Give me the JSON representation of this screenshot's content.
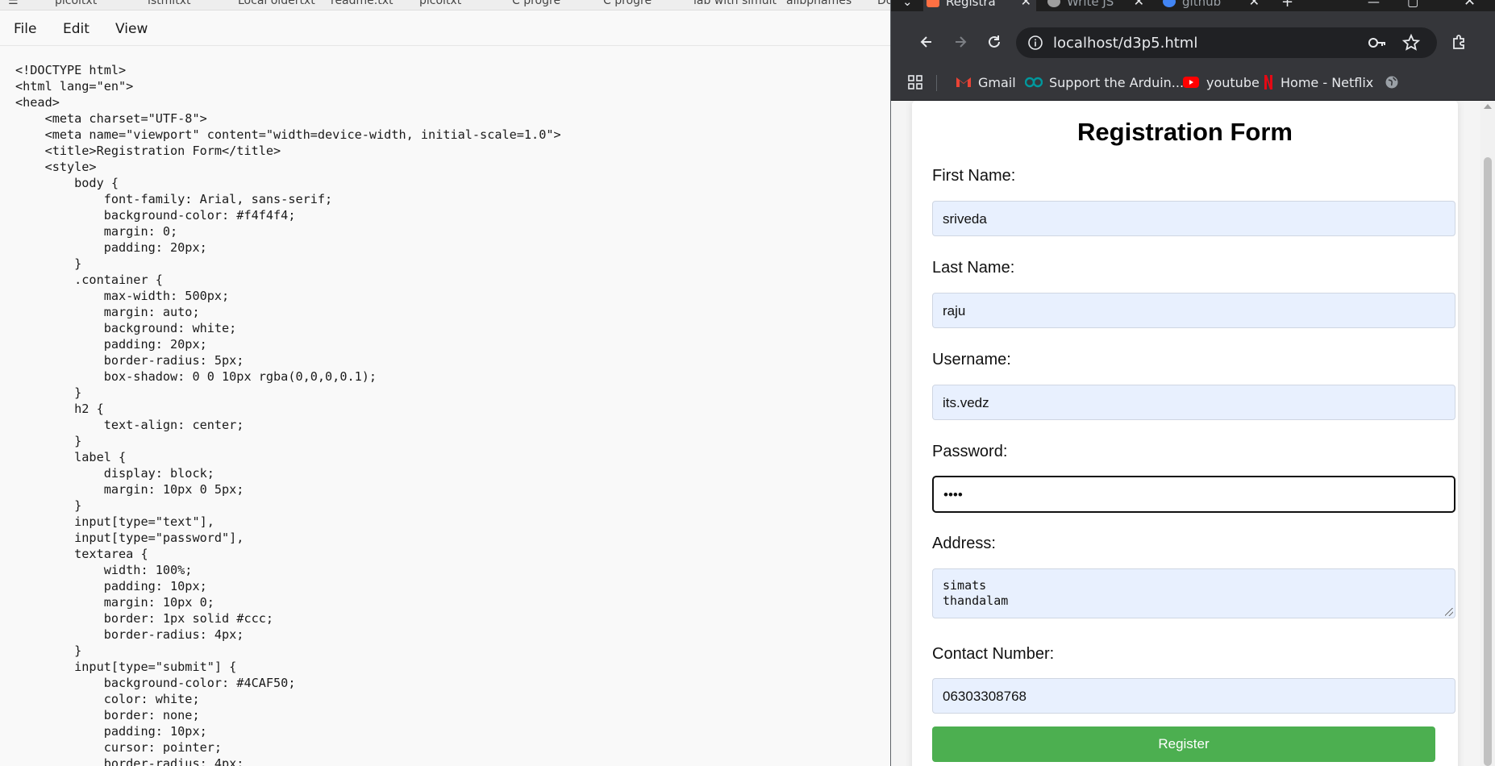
{
  "notepad": {
    "tabs": [
      "picoltxt",
      "istmltxt",
      "Local oldertxt",
      "readme.txt",
      "picoltxt",
      "C progre",
      "C progre",
      "lab with simult",
      "allbpnames",
      "Do"
    ],
    "menu": [
      "File",
      "Edit",
      "View"
    ],
    "code_lines": [
      "<!DOCTYPE html>",
      "<html lang=\"en\">",
      "<head>",
      "    <meta charset=\"UTF-8\">",
      "    <meta name=\"viewport\" content=\"width=device-width, initial-scale=1.0\">",
      "    <title>Registration Form</title>",
      "    <style>",
      "        body {",
      "            font-family: Arial, sans-serif;",
      "            background-color: #f4f4f4;",
      "            margin: 0;",
      "            padding: 20px;",
      "        }",
      "        .container {",
      "            max-width: 500px;",
      "            margin: auto;",
      "            background: white;",
      "            padding: 20px;",
      "            border-radius: 5px;",
      "            box-shadow: 0 0 10px rgba(0,0,0,0.1);",
      "        }",
      "        h2 {",
      "            text-align: center;",
      "        }",
      "        label {",
      "            display: block;",
      "            margin: 10px 0 5px;",
      "        }",
      "        input[type=\"text\"],",
      "        input[type=\"password\"],",
      "        textarea {",
      "            width: 100%;",
      "            padding: 10px;",
      "            margin: 10px 0;",
      "            border: 1px solid #ccc;",
      "            border-radius: 4px;",
      "        }",
      "        input[type=\"submit\"] {",
      "            background-color: #4CAF50;",
      "            color: white;",
      "            border: none;",
      "            padding: 10px;",
      "            cursor: pointer;",
      "            border-radius: 4px;"
    ]
  },
  "browser": {
    "tabs": [
      {
        "title": "Registra",
        "active": true,
        "icon_color": "#ff7043"
      },
      {
        "title": "Write JS",
        "active": false,
        "icon_color": "#9e9e9e"
      },
      {
        "title": "github",
        "active": false,
        "icon_color": "#4285f4"
      }
    ],
    "url": "localhost/d3p5.html",
    "bookmarks": [
      {
        "label": "Gmail",
        "icon": "gmail-icon"
      },
      {
        "label": "Support the Arduin...",
        "icon": "arduino-icon"
      },
      {
        "label": "youtube",
        "icon": "youtube-icon"
      },
      {
        "label": "Home - Netflix",
        "icon": "netflix-icon"
      }
    ]
  },
  "form": {
    "title": "Registration Form",
    "first_name_label": "First Name:",
    "first_name_value": "sriveda",
    "last_name_label": "Last Name:",
    "last_name_value": "raju",
    "username_label": "Username:",
    "username_value": "its.vedz",
    "password_label": "Password:",
    "password_value": "••••",
    "address_label": "Address:",
    "address_value": "simats\nthandalam",
    "contact_label": "Contact Number:",
    "contact_value": "06303308768",
    "submit_label": "Register"
  },
  "colors": {
    "submit": "#4CAF50",
    "autofill": "#e8f0fe",
    "page_bg": "#f4f4f4"
  }
}
